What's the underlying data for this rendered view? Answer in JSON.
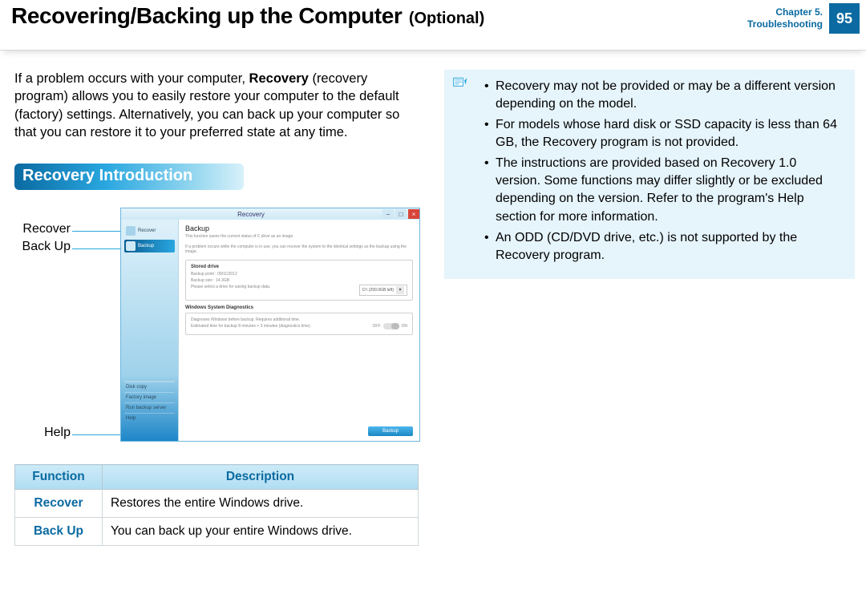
{
  "header": {
    "title": "Recovering/Backing up the Computer",
    "optional": "(Optional)",
    "chapter": "Chapter 5.",
    "section": "Troubleshooting",
    "page": "95"
  },
  "intro": {
    "pre": "If a problem occurs with your computer, ",
    "bold": "Recovery",
    "post": " (recovery program) allows you to easily restore your computer to the default (factory) settings. Alternatively, you can back up your computer so that you can restore it to your preferred state at any time."
  },
  "section_heading": "Recovery Introduction",
  "callouts": {
    "recover": "Recover",
    "backup": "Back Up",
    "help": "Help"
  },
  "app": {
    "title": "Recovery",
    "sidebar": {
      "recover": "Recover",
      "backup": "Backup",
      "disk_copy": "Disk copy",
      "factory_image": "Factory image",
      "run_backup_server": "Run backup server",
      "help": "Help"
    },
    "main": {
      "heading": "Backup",
      "desc1": "This function saves the current status of C drive as an image.",
      "desc2": "If a problem occurs while the computer is in use, you can recover the system to the identical settings as the backup using the image.",
      "panel1_title": "Stored drive",
      "panel1_line1": "Backup point : 09/11/2012",
      "panel1_line2": "Backup size : 14.3GB",
      "panel1_line3": "Please select a drive for saving backup data.",
      "drive_select": "D:\\ (200.0GB left)",
      "panel2_title": "Windows System Diagnostics",
      "panel2_line1": "Diagnoses Windows before backup. Requires additional time.",
      "panel2_line2": "Estimated time for backup 8 minutes + 3 minutes (diagnostics time)",
      "toggle_off": "OFF",
      "toggle_on": "ON",
      "button": "Backup"
    }
  },
  "table": {
    "head_function": "Function",
    "head_description": "Description",
    "rows": [
      {
        "fn": "Recover",
        "desc": "Restores the entire Windows drive."
      },
      {
        "fn": "Back Up",
        "desc": "You can back up your entire Windows drive."
      }
    ]
  },
  "notes": [
    "Recovery may not be provided or may be a different version depending on the model.",
    "For models whose hard disk or SSD capacity is less than 64 GB, the Recovery program is not provided.",
    "The instructions are provided based on Recovery 1.0 version. Some functions may differ slightly or be excluded depending on the version. Refer to the program's Help section for more information.",
    "An ODD (CD/DVD drive, etc.) is not supported by the Recovery program."
  ]
}
